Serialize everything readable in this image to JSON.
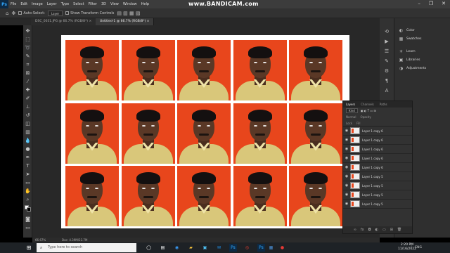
{
  "menubar": {
    "logo": "Ps",
    "items": [
      "File",
      "Edit",
      "Image",
      "Layer",
      "Type",
      "Select",
      "Filter",
      "3D",
      "View",
      "Window",
      "Help"
    ],
    "watermark": "www.BANDICAM.com",
    "window_controls": [
      "–",
      "❐",
      "✕"
    ]
  },
  "options": {
    "auto_select_label": "Auto-Select:",
    "auto_select_value": "Layer",
    "transform_label": "Show Transform Controls"
  },
  "tabs": [
    {
      "label": "DSC_0031.JPG @ 66.7% (RGB/8*)  ×"
    },
    {
      "label": "Untitled-1 @ 66.7% (RGB/8*)  ×"
    }
  ],
  "document": {
    "grid_rows": 3,
    "grid_cols": 5,
    "photo_bg_color": "#e8461c",
    "shirt_color": "#d9c77a"
  },
  "status": {
    "zoom": "66.67%",
    "doc_size": "Doc: 4.39M/22.7M"
  },
  "side_panels": [
    {
      "icon": "color-icon",
      "label": "Color"
    },
    {
      "icon": "swatches-icon",
      "label": "Swatches"
    },
    {
      "icon": "learn-icon",
      "label": "Learn"
    },
    {
      "icon": "libraries-icon",
      "label": "Libraries"
    },
    {
      "icon": "adjustments-icon",
      "label": "Adjustments"
    }
  ],
  "layers_panel": {
    "tabs": [
      "Layers",
      "Channels",
      "Paths"
    ],
    "filter_label": "Kind",
    "row2": [
      "Normal",
      "Opacity"
    ],
    "row3": [
      "Lock",
      "Fill"
    ],
    "layers": [
      "Layer 1 copy 6",
      "Layer 1 copy 6",
      "Layer 1 copy 6",
      "Layer 1 copy 6",
      "Layer 1 copy 6",
      "Layer 1 copy 5",
      "Layer 1 copy 5",
      "Layer 1 copy 5",
      "Layer 1 copy 5"
    ]
  },
  "taskbar": {
    "search_placeholder": "Type here to search",
    "language": "ENG",
    "region": "US",
    "time": "2:20 PM",
    "date": "11/16/2022"
  }
}
